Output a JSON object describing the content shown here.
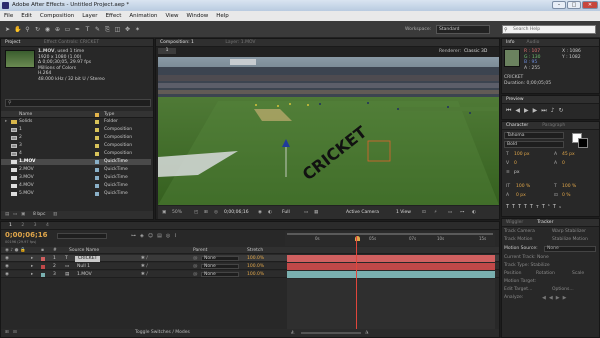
{
  "window": {
    "title": "Adobe After Effects - Untitled Project.aep *",
    "min": "–",
    "max": "□",
    "close": "✕"
  },
  "menu": [
    "File",
    "Edit",
    "Composition",
    "Layer",
    "Effect",
    "Animation",
    "View",
    "Window",
    "Help"
  ],
  "toolbar": {
    "workspace_label": "Workspace:",
    "workspace_value": "Standard",
    "search_placeholder": "Search Help"
  },
  "project": {
    "tab": "Project",
    "effect_tab": "Effect Controls: CRICKET",
    "selected_name": "1.MOV",
    "used": ", used 1 time",
    "info": [
      "1920 x 1080 (1.00)",
      "Δ 0;00;30;05, 29.97 fps",
      "Millions of Colors",
      "H.264",
      "48.000 kHz / 32 bit U / Stereo"
    ],
    "columns": {
      "name": "Name",
      "type": "Type"
    },
    "items": [
      {
        "name": "Solids",
        "type": "Folder",
        "color": "#d8c35a"
      },
      {
        "name": "1",
        "type": "Composition",
        "color": "#d8c35a"
      },
      {
        "name": "2",
        "type": "Composition",
        "color": "#d8c35a"
      },
      {
        "name": "3",
        "type": "Composition",
        "color": "#d8c35a"
      },
      {
        "name": "4",
        "type": "Composition",
        "color": "#d8c35a"
      },
      {
        "name": "1.MOV",
        "type": "QuickTime",
        "color": "#8ab0c8"
      },
      {
        "name": "2.MOV",
        "type": "QuickTime",
        "color": "#8ab0c8"
      },
      {
        "name": "3.MOV",
        "type": "QuickTime",
        "color": "#8ab0c8"
      },
      {
        "name": "4.MOV",
        "type": "QuickTime",
        "color": "#8ab0c8"
      },
      {
        "name": "5.MOV",
        "type": "QuickTime",
        "color": "#8ab0c8"
      }
    ],
    "bpc": "8 bpc"
  },
  "comp": {
    "tab": "Composition: 1",
    "layer_tab": "Layer: 1.MOV",
    "tab_label": "1",
    "renderer_label": "Renderer:",
    "renderer_value": "Classic 3D",
    "overlay_text": "CRICKET",
    "zoom": "50%",
    "timecode": "0;00;06;16",
    "quality": "Full",
    "camera": "Active Camera",
    "views": "1 View"
  },
  "info_panel": {
    "tabs": [
      "Info",
      "Audio"
    ],
    "R": "R : 107",
    "G": "G : 130",
    "B": "B : 95",
    "A": "A : 255",
    "X": "X : 1086",
    "Y": "Y : 1082",
    "layer_name": "CRICKET",
    "duration": "Duration: 0;00;05;05"
  },
  "preview_tab": "Preview",
  "character": {
    "tabs": [
      "Character",
      "Paragraph"
    ],
    "font": "Tahoma",
    "style": "Bold",
    "size": "100 px",
    "leading": "45 px",
    "kerning": "0",
    "tracking": "0",
    "stroke": "px",
    "vscale": "100 %",
    "hscale": "100 %",
    "baseline": "0 px",
    "tsume": "0 %"
  },
  "wiggler": {
    "tabs": [
      "Wiggler",
      "Tracker"
    ],
    "buttons": [
      "Track Camera",
      "Warp Stabilizer",
      "Track Motion",
      "Stabilize Motion"
    ],
    "motion_source_label": "Motion Source:",
    "motion_source_value": "None",
    "rows": [
      "Current Track: None",
      "Track Type: Stabilize",
      "Position",
      "Rotation",
      "Scale",
      "Motion Target:",
      "Edit Target...",
      "Options...",
      "Analyze:"
    ]
  },
  "timeline": {
    "timecode": "0;00;06;16",
    "frames": "00196 (29.97 fps)",
    "tabs": [
      "1",
      "2",
      "3",
      "4"
    ],
    "columns": {
      "num": "#",
      "source": "Source Name",
      "parent": "Parent",
      "stretch": "Stretch"
    },
    "layers": [
      {
        "num": "1",
        "name": "CRICKET",
        "parent": "None",
        "stretch": "100.0%",
        "color": "#d06060"
      },
      {
        "num": "2",
        "name": "Null 1",
        "parent": "None",
        "stretch": "100.0%",
        "color": "#c04848"
      },
      {
        "num": "3",
        "name": "1.MOV",
        "parent": "None",
        "stretch": "100.0%",
        "color": "#7ab0b0"
      }
    ],
    "ruler": [
      "0s",
      "05s",
      "07s",
      "10s",
      "15s"
    ],
    "toggle": "Toggle Switches / Modes"
  }
}
